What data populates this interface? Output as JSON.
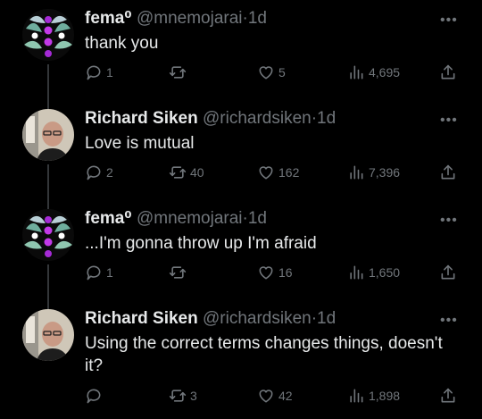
{
  "tweets": [
    {
      "name": "fema⁰",
      "handle": "@mnemojarai",
      "separator": "·",
      "time": "1d",
      "text": "thank you",
      "replies": "1",
      "retweets": "",
      "likes": "5",
      "views": "4,695",
      "avatar": "fema-avatar"
    },
    {
      "name": "Richard Siken",
      "handle": "@richardsiken",
      "separator": "·",
      "time": "1d",
      "text": "Love is mutual",
      "replies": "2",
      "retweets": "40",
      "likes": "162",
      "views": "7,396",
      "avatar": "siken-avatar"
    },
    {
      "name": "fema⁰",
      "handle": "@mnemojarai",
      "separator": "·",
      "time": "1d",
      "text": "...I'm gonna throw up I'm afraid",
      "replies": "1",
      "retweets": "",
      "likes": "16",
      "views": "1,650",
      "avatar": "fema-avatar"
    },
    {
      "name": "Richard Siken",
      "handle": "@richardsiken",
      "separator": "·",
      "time": "1d",
      "text": "Using the correct terms changes things, doesn't it?",
      "replies": "",
      "retweets": "3",
      "likes": "42",
      "views": "1,898",
      "avatar": "siken-avatar"
    }
  ],
  "colors": {
    "background": "#000000",
    "text": "#e7e9ea",
    "muted": "#71767b",
    "thread_line": "#333639"
  },
  "icons": [
    "more-icon",
    "reply-icon",
    "retweet-icon",
    "like-icon",
    "views-icon",
    "share-icon"
  ]
}
